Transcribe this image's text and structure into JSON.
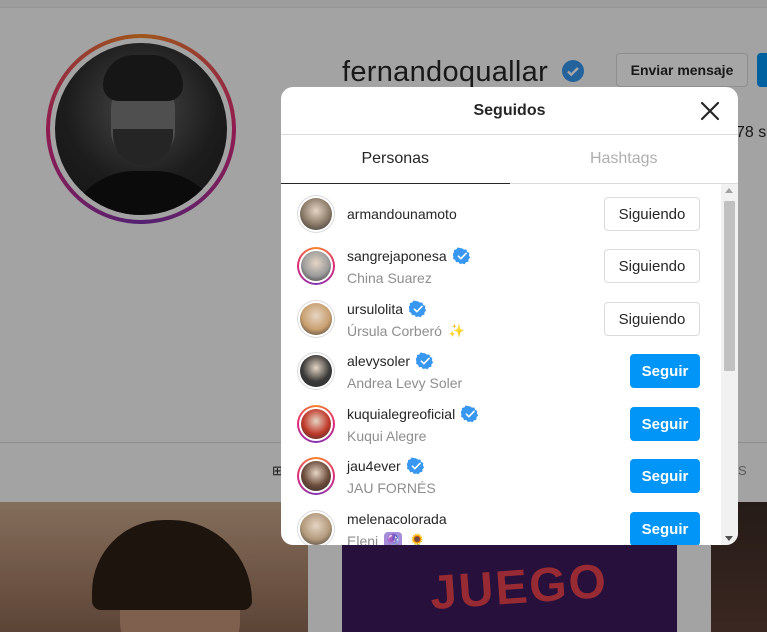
{
  "profile": {
    "username": "fernandoquallar",
    "message_button": "Enviar mensaje",
    "stat_partial": "78 s",
    "tab_left_partial": "⊞",
    "tab_right_partial": "S",
    "post_text": "JUEGO"
  },
  "modal": {
    "title": "Seguidos",
    "close_icon": "close-icon",
    "tabs": [
      {
        "label": "Personas",
        "active": true
      },
      {
        "label": "Hashtags",
        "active": false
      }
    ],
    "rows": [
      {
        "username": "armandounamoto",
        "full_name": "",
        "verified": false,
        "story_ring": false,
        "button": "Siguiendo",
        "avatar_color": "#8a7a68"
      },
      {
        "username": "sangrejaponesa",
        "full_name": "China Suarez",
        "verified": true,
        "story_ring": true,
        "button": "Siguiendo",
        "avatar_color": "#9c9c9c"
      },
      {
        "username": "ursulolita",
        "full_name": "Úrsula Corberó",
        "verified": true,
        "story_ring": false,
        "button": "Siguiendo",
        "avatar_color": "#c9a070",
        "emoji": "✨"
      },
      {
        "username": "alevysoler",
        "full_name": "Andrea Levy Soler",
        "verified": true,
        "story_ring": false,
        "button": "Seguir",
        "avatar_color": "#3a3a3a"
      },
      {
        "username": "kuquialegreoficial",
        "full_name": "Kuqui Alegre",
        "verified": true,
        "story_ring": true,
        "button": "Seguir",
        "avatar_color": "#c0392b"
      },
      {
        "username": "jau4ever",
        "full_name": "JAU FORNÉS",
        "verified": true,
        "story_ring": true,
        "button": "Seguir",
        "avatar_color": "#6b4a3a"
      },
      {
        "username": "melenacolorada",
        "full_name": "Eleni",
        "verified": false,
        "story_ring": false,
        "button": "Seguir",
        "avatar_color": "#b39a7c",
        "emoji": "🔮",
        "emoji2": "🌻"
      }
    ]
  },
  "colors": {
    "accent": "#0095f6",
    "verified": "#3897f0",
    "muted": "#8e8e8e"
  }
}
